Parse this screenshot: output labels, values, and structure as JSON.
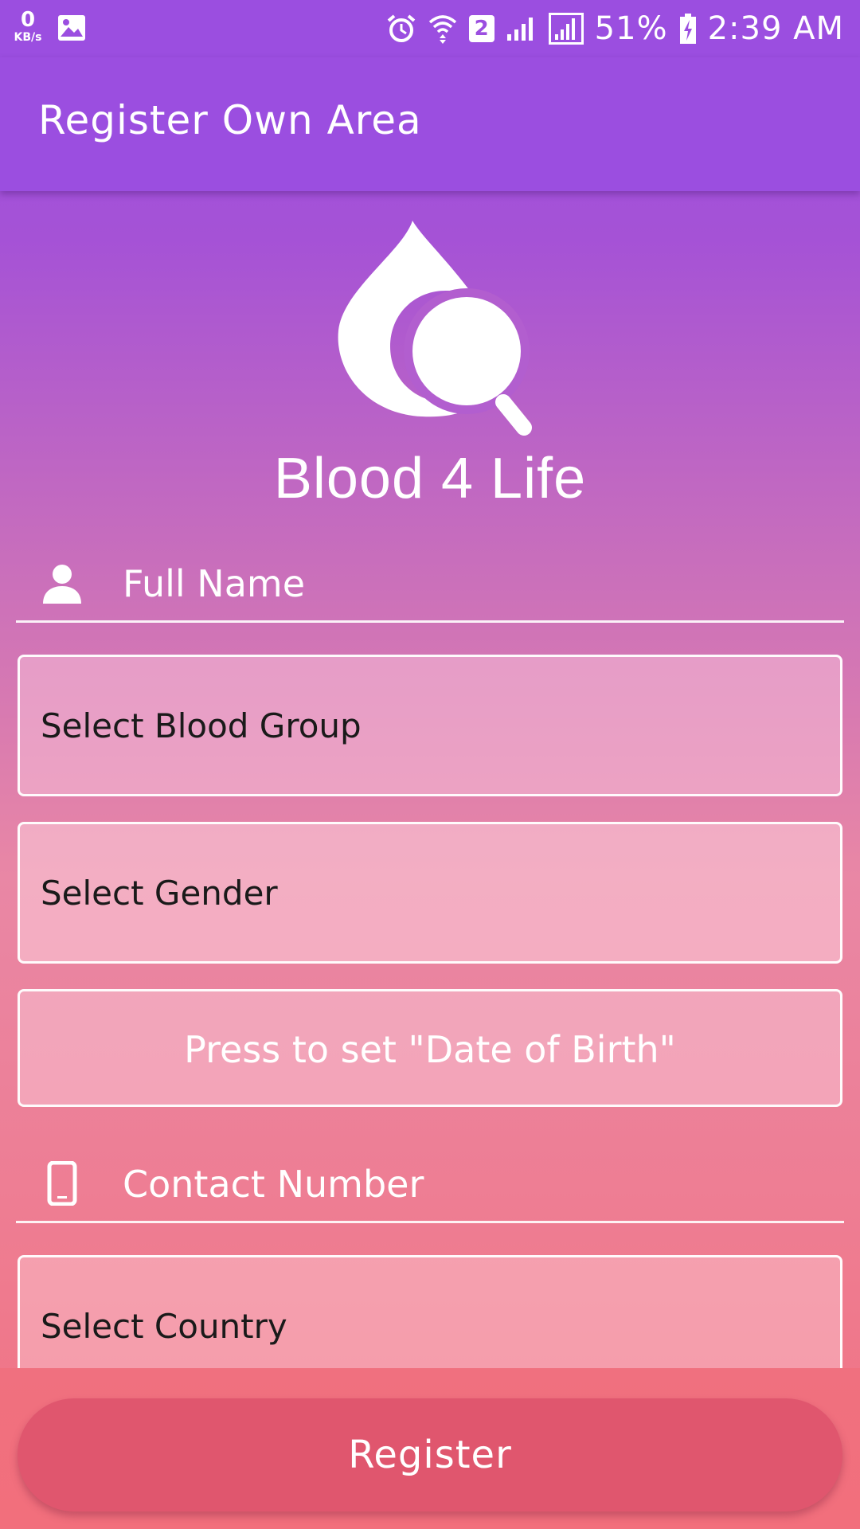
{
  "status_bar": {
    "speed_value": "0",
    "speed_unit": "KB/s",
    "sim_slot": "2",
    "battery": "51%",
    "time": "2:39 AM"
  },
  "app_bar": {
    "title": "Register Own Area"
  },
  "logo": {
    "text": "Blood 4 Life"
  },
  "form": {
    "full_name_placeholder": "Full Name",
    "blood_group_label": "Select Blood Group",
    "gender_label": "Select Gender",
    "dob_button_label": "Press to set \"Date of Birth\"",
    "contact_placeholder": "Contact Number",
    "country_label": "Select Country"
  },
  "register_button": {
    "label": "Register"
  },
  "colors": {
    "primary": "#9b4ee0",
    "button": "#e0566e"
  }
}
